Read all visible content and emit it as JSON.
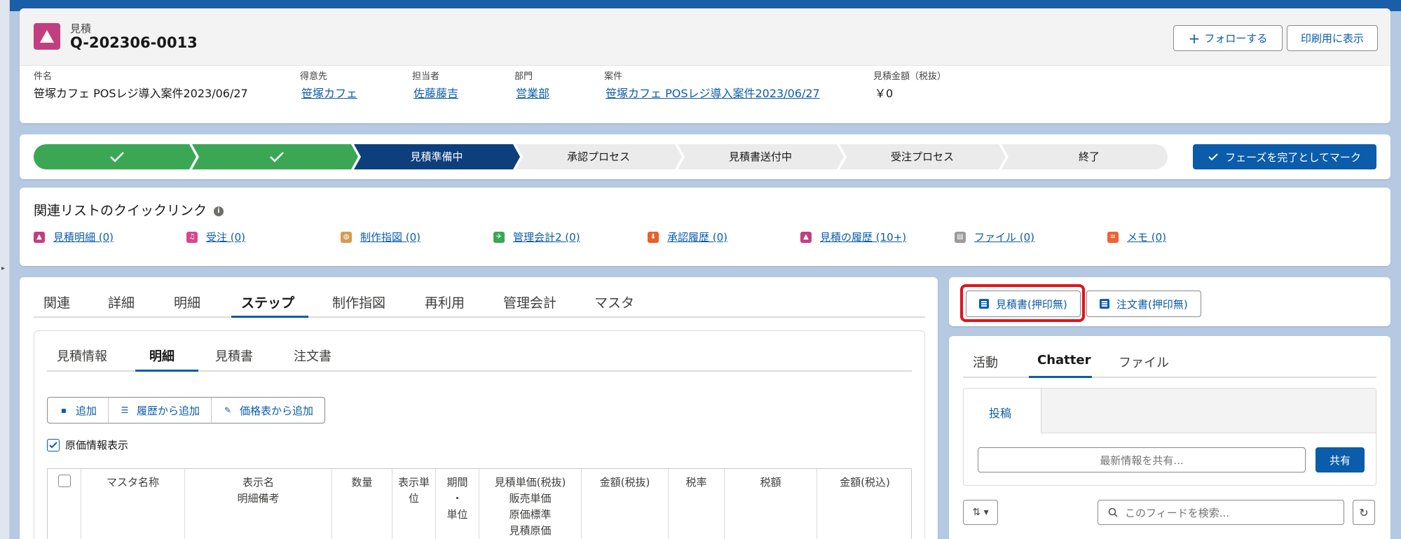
{
  "header": {
    "object_label": "見積",
    "record_title": "Q-202306-0013",
    "follow_button": "フォローする",
    "print_button": "印刷用に表示",
    "fields": [
      {
        "label": "件名",
        "value": "笹塚カフェ POSレジ導入案件2023/06/27",
        "link": false
      },
      {
        "label": "得意先",
        "value": "笹塚カフェ",
        "link": true
      },
      {
        "label": "担当者",
        "value": "佐藤藤吉",
        "link": true
      },
      {
        "label": "部門",
        "value": "営業部",
        "link": true
      },
      {
        "label": "案件",
        "value": "笹塚カフェ POSレジ導入案件2023/06/27",
        "link": true
      },
      {
        "label": "見積金額（税抜）",
        "value": "￥0",
        "link": false
      }
    ]
  },
  "path": {
    "stages": [
      "",
      "",
      "見積準備中",
      "承認プロセス",
      "見積書送付中",
      "受注プロセス",
      "終了"
    ],
    "complete_button": "フェーズを完了としてマーク"
  },
  "quick_links": {
    "title": "関連リストのクイックリンク",
    "items": [
      {
        "label": "見積明細 (0)",
        "color": "#c23f7f"
      },
      {
        "label": "受注 (0)",
        "color": "#d8468c"
      },
      {
        "label": "制作指図 (0)",
        "color": "#d29d53"
      },
      {
        "label": "管理会計2 (0)",
        "color": "#3ba755"
      },
      {
        "label": "承認履歴 (0)",
        "color": "#e8602a"
      },
      {
        "label": "見積の履歴 (10+)",
        "color": "#c23f7f"
      },
      {
        "label": "ファイル (0)",
        "color": "#9a9a9a"
      },
      {
        "label": "メモ (0)",
        "color": "#f06234"
      }
    ]
  },
  "main_tabs": [
    "関連",
    "詳細",
    "明細",
    "ステップ",
    "制作指図",
    "再利用",
    "管理会計",
    "マスタ"
  ],
  "sub_tabs": [
    "見積情報",
    "明細",
    "見積書",
    "注文書"
  ],
  "line_buttons": [
    "追加",
    "履歴から追加",
    "価格表から追加"
  ],
  "cost_checkbox_label": "原価情報表示",
  "table_headers": [
    "",
    "マスタ名称",
    "表示名\n明細備考",
    "数量",
    "表示単\n位",
    "期間\n・\n単位",
    "見積単価(税抜)\n販売単価\n原価標準\n見積原価",
    "金額(税抜)",
    "税率",
    "税額",
    "金額(税込)"
  ],
  "right_buttons": [
    "見積書(押印無)",
    "注文書(押印無)"
  ],
  "feed": {
    "tabs": [
      "活動",
      "Chatter",
      "ファイル"
    ],
    "post_tab": "投稿",
    "share_placeholder": "最新情報を共有...",
    "share_button": "共有",
    "search_placeholder": "このフィードを検索..."
  }
}
